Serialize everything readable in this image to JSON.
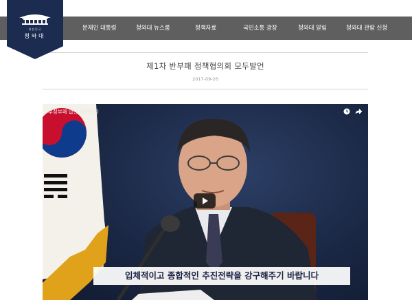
{
  "logo": {
    "small_text": "대한민국",
    "main_text": "청와대"
  },
  "nav": {
    "items": [
      {
        "label": "문재인 대통령"
      },
      {
        "label": "청와대 뉴스룸"
      },
      {
        "label": "정책자료"
      },
      {
        "label": "국민소통 광장"
      },
      {
        "label": "청와대 알림"
      },
      {
        "label": "청와대 관람 신청"
      }
    ]
  },
  "article": {
    "title": "제1차 반부패 정책협의회 모두발언",
    "date": "2017-09-26"
  },
  "video": {
    "title": "부정부패 없는 대한민국",
    "caption": "입체적이고 종합적인 추진전략을 강구해주기 바랍니다",
    "icons": [
      "clock-icon",
      "share-icon",
      "play-icon"
    ]
  },
  "colors": {
    "nav_bg": "#5f5f5f",
    "logo_bg": "#1c2c51",
    "caption_text": "#1a2244"
  }
}
